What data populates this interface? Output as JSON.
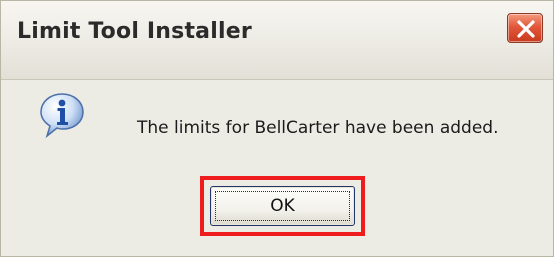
{
  "window": {
    "title": "Limit Tool Installer",
    "close_icon": "close-icon"
  },
  "dialog": {
    "icon": "information-icon",
    "message": "The limits for BellCarter have been added."
  },
  "buttons": {
    "ok_label": "OK"
  },
  "colors": {
    "highlight_box": "#ee1c1c",
    "close_button": "#d9482b",
    "dialog_background": "#ecebe4"
  }
}
